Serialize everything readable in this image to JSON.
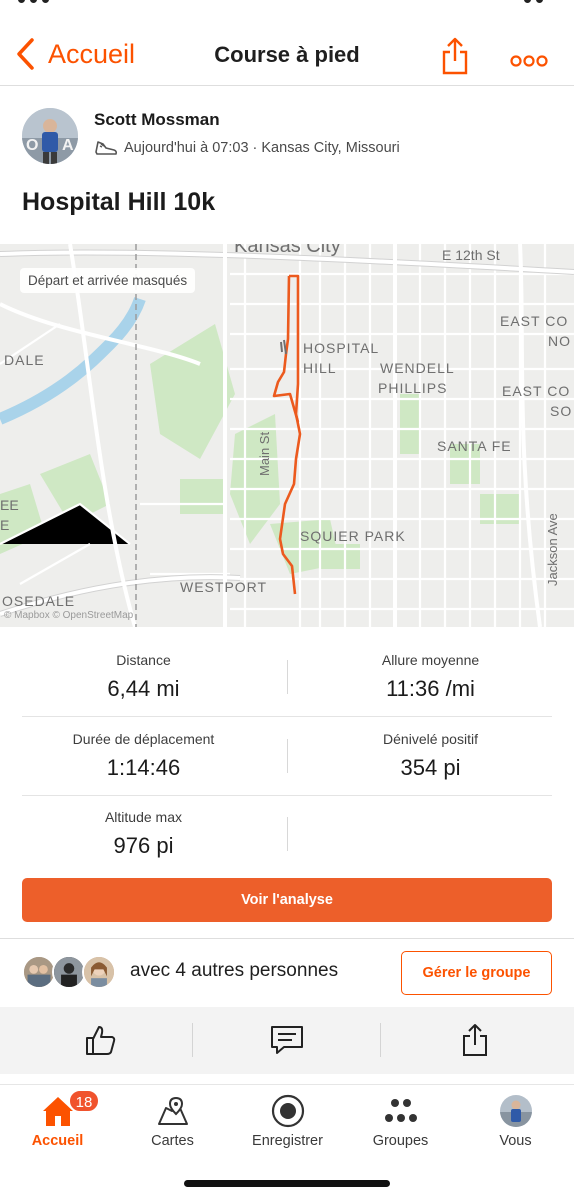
{
  "header": {
    "back_label": "Accueil",
    "title": "Course à pied"
  },
  "athlete": {
    "name": "Scott Mossman",
    "meta": "Aujourd'hui à 07:03 · Kansas City, Missouri"
  },
  "activity": {
    "title": "Hospital Hill 10k"
  },
  "map": {
    "privacy_label": "Départ et arrivée masqués",
    "attribution": "© Mapbox © OpenStreetMap",
    "labels": {
      "kansas_city": "Kansas City",
      "e12th": "E 12th St",
      "east_co_1": "EAST CO",
      "no": "NO",
      "dale": "DALE",
      "hospital": "HOSPITAL",
      "hill": "HILL",
      "wendell": "WENDELL",
      "phillips": "PHILLIPS",
      "east_co_2": "EAST CO",
      "so": "SO",
      "santa_fe": "SANTA FE",
      "main_st": "Main St",
      "squier_park": "SQUIER PARK",
      "jackson_ave": "Jackson Ave",
      "westport": "WESTPORT",
      "osedale": "OSEDALE",
      "ee": "EE",
      "e_lower": "E"
    },
    "route_color": "#ec5a1e"
  },
  "stats": {
    "distance": {
      "label": "Distance",
      "value": "6,44 mi"
    },
    "pace": {
      "label": "Allure moyenne",
      "value": "11:36 /mi"
    },
    "moving_time": {
      "label": "Durée de déplacement",
      "value": "1:14:46"
    },
    "elevation_gain": {
      "label": "Dénivelé positif",
      "value": "354 pi"
    },
    "max_elevation": {
      "label": "Altitude max",
      "value": "976 pi"
    }
  },
  "analysis_button": "Voir l'analyse",
  "group": {
    "text": "avec 4 autres personnes",
    "button": "Gérer le groupe"
  },
  "tabs": {
    "home": "Accueil",
    "maps": "Cartes",
    "record": "Enregistrer",
    "groups": "Groupes",
    "you": "Vous"
  },
  "notifications_badge": "18",
  "colors": {
    "accent": "#fc5200",
    "button": "#ed5f2a",
    "badge": "#f0532d",
    "water": "#a9d3ea",
    "park": "#cfe8c4"
  },
  "icons": [
    "chevron-left-icon",
    "share-icon",
    "more-icon",
    "shoe-icon",
    "like-icon",
    "comment-icon",
    "home-icon",
    "maps-icon",
    "record-icon",
    "groups-icon"
  ]
}
